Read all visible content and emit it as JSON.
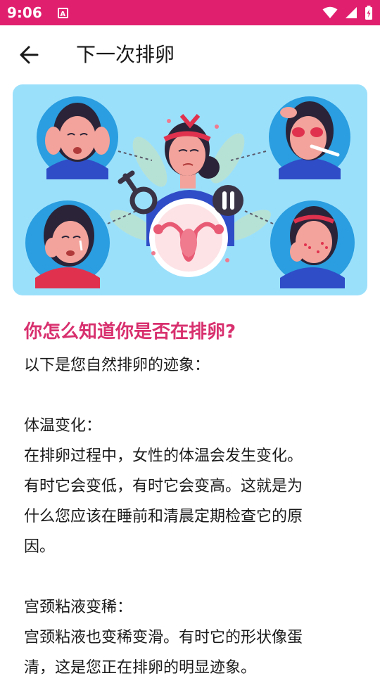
{
  "status_bar": {
    "time": "9:06",
    "notification_icon": "A",
    "icons": [
      "wifi-icon",
      "signal-icon",
      "battery-icon"
    ]
  },
  "app_bar": {
    "back_icon": "arrow-left-icon",
    "title": "下一次排卵"
  },
  "hero": {
    "illustration": "ovulation-symptoms-illustration",
    "colors": {
      "background": "#9be0fb",
      "skin": "#f3a39b",
      "hair": "#2b2438",
      "accent": "#e0206e"
    }
  },
  "article": {
    "question": "你怎么知道你是否在排卵?",
    "intro": "以下是您自然排卵的迹象：",
    "sections": [
      {
        "heading": "体温变化：",
        "lines": [
          "在排卵过程中，女性的体温会发生变化。",
          "有时它会变低，有时它会变高。这就是为",
          "什么您应该在睡前和清晨定期检查它的原",
          "因。"
        ]
      },
      {
        "heading": "宫颈粘液变稀：",
        "lines": [
          "宫颈粘液也变稀变滑。有时它的形状像蛋",
          "清，这是您正在排卵的明显迹象。"
        ]
      }
    ]
  },
  "colors": {
    "status_bar": "#e0206e",
    "question": "#d8306e"
  }
}
